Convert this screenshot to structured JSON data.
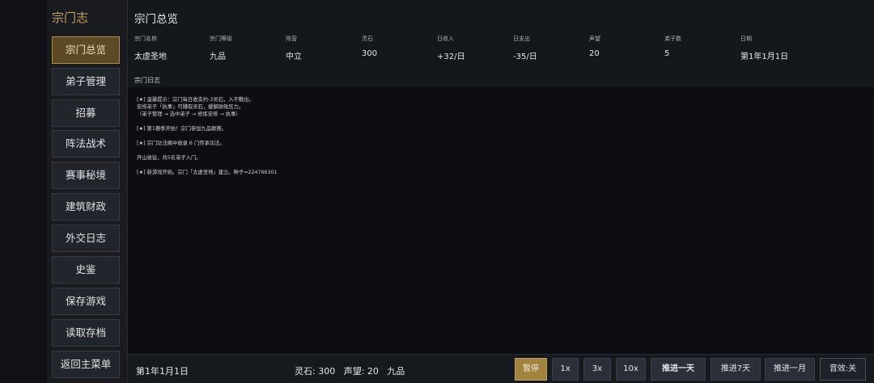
{
  "sidebar": {
    "title": "宗门志",
    "items": [
      {
        "label": "宗门总览"
      },
      {
        "label": "弟子管理"
      },
      {
        "label": "招募"
      },
      {
        "label": "阵法战术"
      },
      {
        "label": "赛事秘境"
      },
      {
        "label": "建筑财政"
      },
      {
        "label": "外交日志"
      },
      {
        "label": "史鉴"
      },
      {
        "label": "保存游戏"
      },
      {
        "label": "读取存档"
      },
      {
        "label": "返回主菜单"
      }
    ]
  },
  "main": {
    "title": "宗门总览",
    "stats": [
      {
        "label": "宗门名称",
        "value": "太虚圣地"
      },
      {
        "label": "宗门等级",
        "value": "九品"
      },
      {
        "label": "阵营",
        "value": "中立"
      },
      {
        "label": "灵石",
        "value": "300"
      },
      {
        "label": "日收入",
        "value": "+32/日"
      },
      {
        "label": "日支出",
        "value": "-35/日"
      },
      {
        "label": "声望",
        "value": "20"
      },
      {
        "label": "弟子数",
        "value": "5"
      },
      {
        "label": "日期",
        "value": "第1年1月1日"
      }
    ],
    "log_title": "宗门日志",
    "log_lines": [
      "[★] 温馨提示：宗门每日收支约-3灵石，入不敷出。",
      "安排弟子「执事」可赚取灵石，缓解财政压力。",
      "（弟子管理 → 选中弟子 → 修炼安排 → 执事）",
      "[★] 第1赛季开始！宗门参加九品联赛。",
      "[★] 宗门功法阁中收录 6 门传承功法。",
      "开山收徒，共5名弟子入门。",
      "[★] 新游戏开始。宗门「太虚圣地」建立。种子=224766301"
    ]
  },
  "status_bar": {
    "date": "第1年1月1日",
    "resources": "灵石: 300   声望: 20   九品",
    "buttons": {
      "pause": "暂停",
      "speed_1x": "1x",
      "speed_3x": "3x",
      "speed_10x": "10x",
      "advance_day": "推进一天",
      "advance_7days": "推进7天",
      "advance_month": "推进一月",
      "sound": "音效:关"
    }
  },
  "colors": {
    "accent_gold": "#c9a557",
    "active_tab": "#5c4a24",
    "pause_button": "#a2823f",
    "background": "#14171c"
  }
}
